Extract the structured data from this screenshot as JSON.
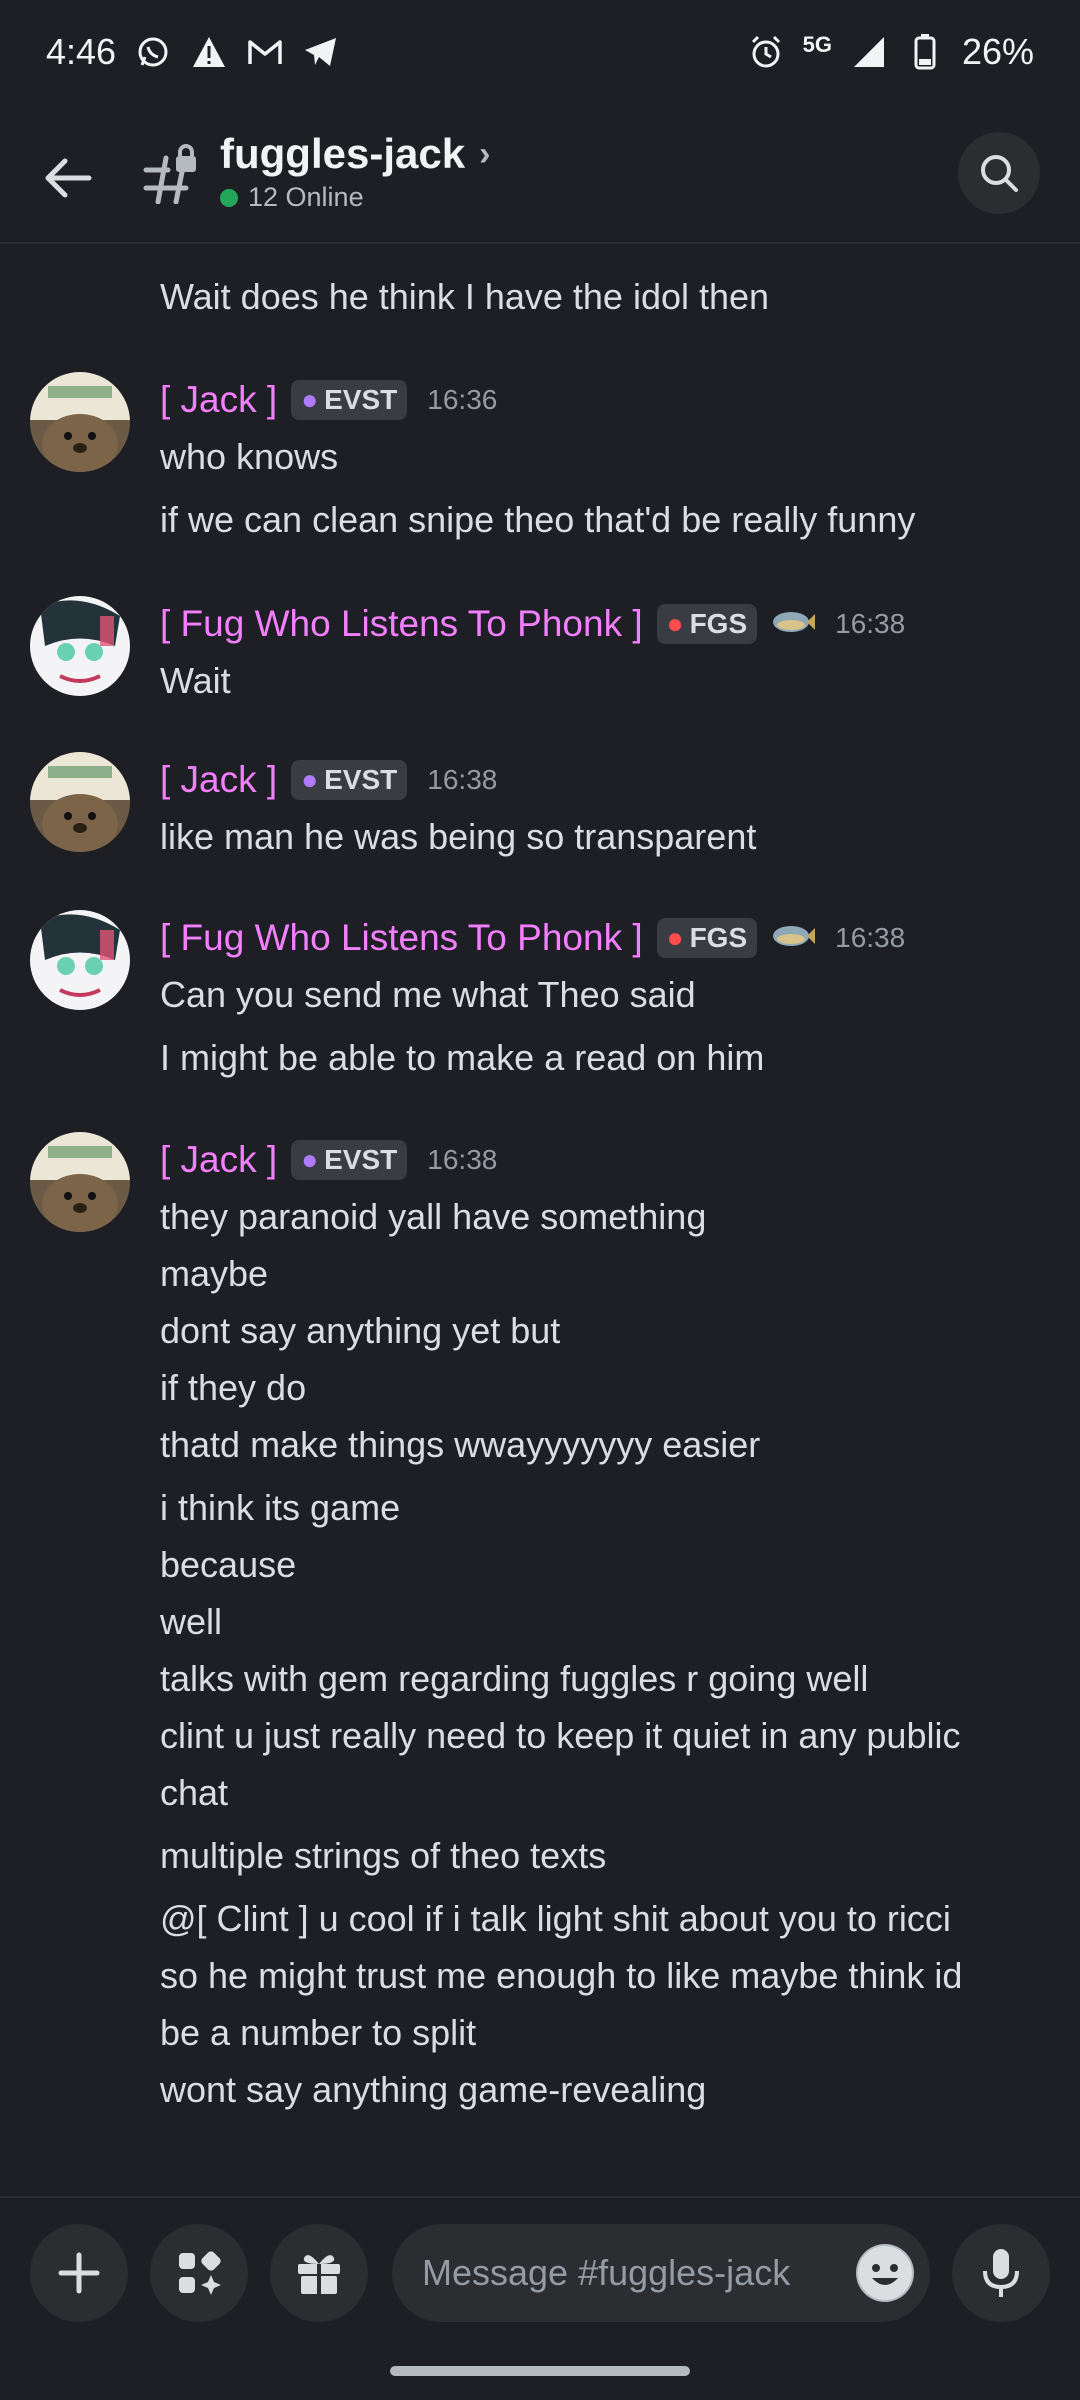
{
  "status_bar": {
    "time": "4:46",
    "network": "5G",
    "battery": "26%"
  },
  "header": {
    "channel_name": "fuggles-jack",
    "online_text": "12 Online",
    "online_color": "#23a55a"
  },
  "messages": {
    "top_partial_line": "Wait does he think I have the idol then",
    "groups": [
      {
        "username": "[ Jack ]",
        "tag": "EVST",
        "time": "16:36",
        "lines": [
          "who knows",
          "if we can clean snipe theo that'd be really funny"
        ]
      },
      {
        "username": "[ Fug Who Listens To Phonk ]",
        "tag": "FGS",
        "time": "16:38",
        "lines": [
          "Wait"
        ]
      },
      {
        "username": "[ Jack ]",
        "tag": "EVST",
        "time": "16:38",
        "lines": [
          "like man he was being so transparent"
        ]
      },
      {
        "username": "[ Fug Who Listens To Phonk ]",
        "tag": "FGS",
        "time": "16:38",
        "lines": [
          "Can you send me what Theo said",
          "I might be able to make a read on him"
        ]
      },
      {
        "username": "[ Jack ]",
        "tag": "EVST",
        "time": "16:38",
        "lines": [
          "they paranoid yall have something",
          "maybe",
          "dont say anything yet but",
          "if they do",
          "thatd make things wwayyyyyyy easier",
          "i think its game",
          "because",
          "well",
          "talks with gem regarding fuggles r going well",
          "clint u just really need to keep it quiet in any public",
          "chat",
          "multiple strings of theo texts",
          "@[ Clint ] u cool if i talk light shit about you to ricci",
          "so he might trust me enough to like maybe think id",
          "be a number to split",
          "wont say anything game-revealing"
        ]
      }
    ]
  },
  "composer": {
    "placeholder": "Message #fuggles-jack"
  },
  "colors": {
    "username": "#f47fff",
    "background": "#1e1f24",
    "surface": "#2b2d31"
  }
}
